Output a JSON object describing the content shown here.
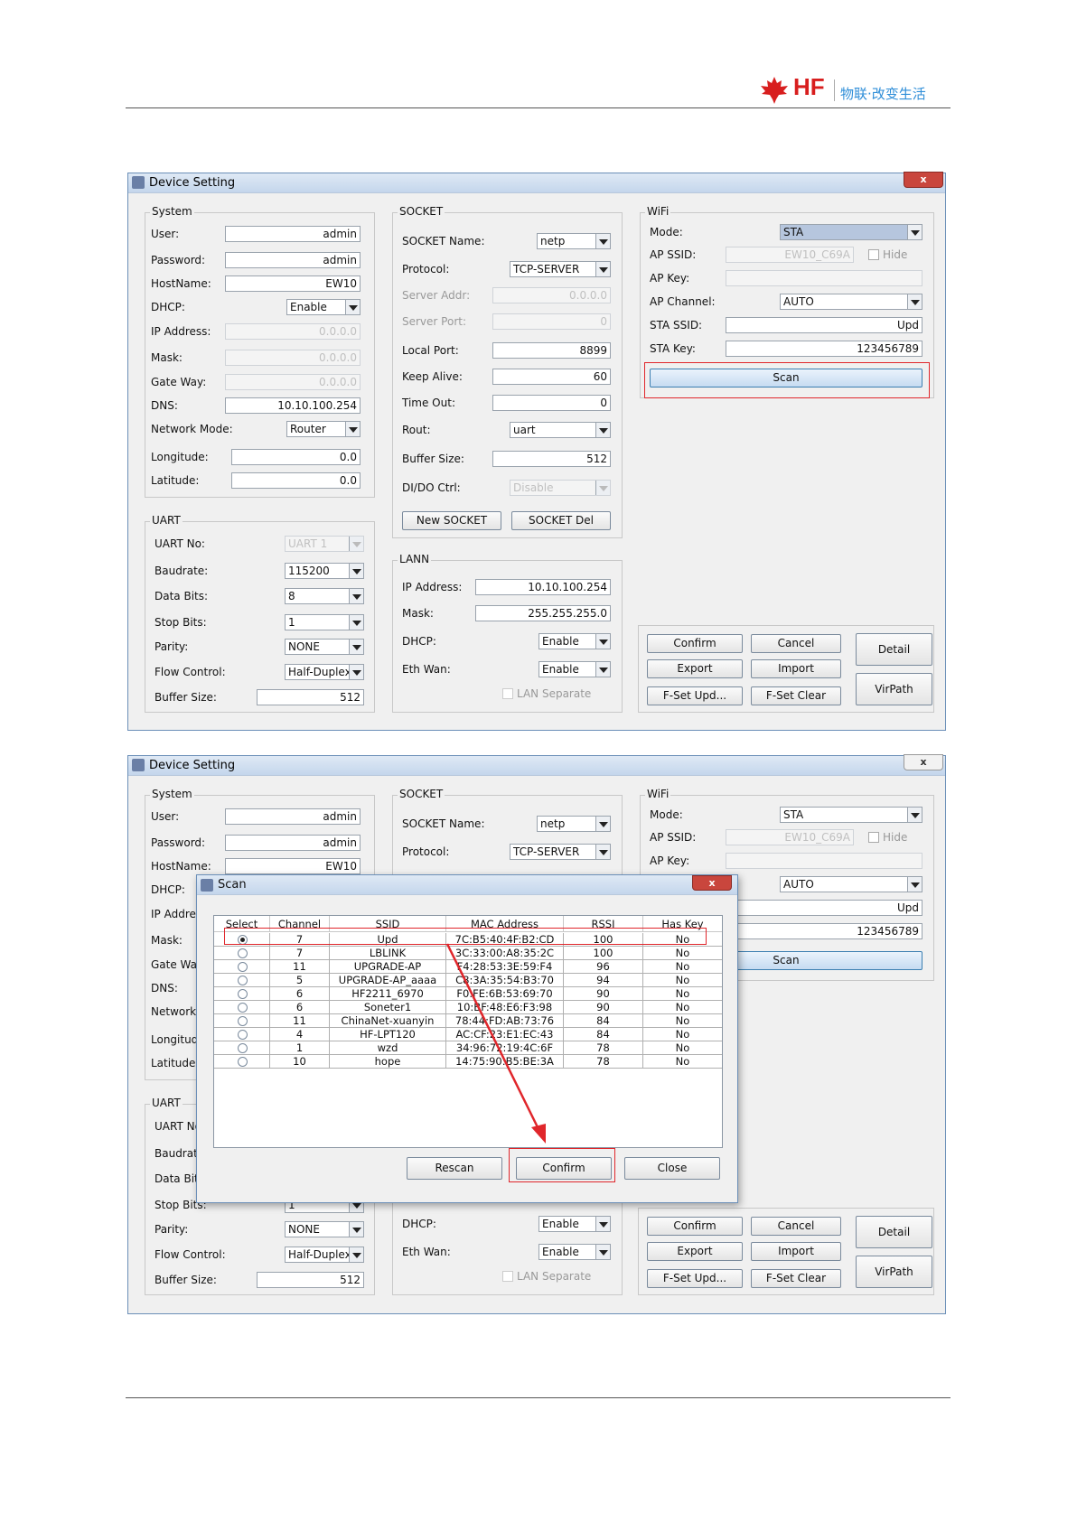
{
  "header": {
    "logo_text": "HF",
    "slogan": "物联·改变生活"
  },
  "device_window_title": "Device Setting",
  "close_glyph": "x",
  "system": {
    "legend": "System",
    "user_label": "User:",
    "user_value": "admin",
    "password_label": "Password:",
    "password_value": "admin",
    "hostname_label": "HostName:",
    "hostname_value": "EW10",
    "dhcp_label": "DHCP:",
    "dhcp_value": "Enable",
    "ip_label": "IP Address:",
    "ip_value": "0.0.0.0",
    "mask_label": "Mask:",
    "mask_value": "0.0.0.0",
    "gateway_label": "Gate Way:",
    "gateway_value": "0.0.0.0",
    "dns_label": "DNS:",
    "dns_value": "10.10.100.254",
    "netmode_label": "Network Mode:",
    "netmode_value": "Router",
    "longitude_label": "Longitude:",
    "longitude_value": "0.0",
    "latitude_label": "Latitude:",
    "latitude_value": "0.0"
  },
  "uart": {
    "legend": "UART",
    "no_label": "UART No:",
    "no_value": "UART 1",
    "baud_label": "Baudrate:",
    "baud_value": "115200",
    "databits_label": "Data Bits:",
    "databits_value": "8",
    "stopbits_label": "Stop Bits:",
    "stopbits_value": "1",
    "parity_label": "Parity:",
    "parity_value": "NONE",
    "flow_label": "Flow Control:",
    "flow_value": "Half-Duplex",
    "buffer_label": "Buffer Size:",
    "buffer_value": "512"
  },
  "socket": {
    "legend": "SOCKET",
    "name_label": "SOCKET Name:",
    "name_value": "netp",
    "protocol_label": "Protocol:",
    "protocol_value": "TCP-SERVER",
    "server_addr_label": "Server Addr:",
    "server_addr_value": "0.0.0.0",
    "server_port_label": "Server Port:",
    "server_port_value": "0",
    "local_port_label": "Local Port:",
    "local_port_value": "8899",
    "keepalive_label": "Keep Alive:",
    "keepalive_value": "60",
    "timeout_label": "Time Out:",
    "timeout_value": "0",
    "rout_label": "Rout:",
    "rout_value": "uart",
    "buffer_label": "Buffer Size:",
    "buffer_value": "512",
    "dido_label": "DI/DO Ctrl:",
    "dido_value": "Disable",
    "new_btn": "New SOCKET",
    "del_btn": "SOCKET Del"
  },
  "lann": {
    "legend": "LANN",
    "ip_label": "IP Address:",
    "ip_value": "10.10.100.254",
    "mask_label": "Mask:",
    "mask_value": "255.255.255.0",
    "dhcp_label": "DHCP:",
    "dhcp_value": "Enable",
    "ethwan_label": "Eth Wan:",
    "ethwan_value": "Enable",
    "separate_label": "LAN Separate"
  },
  "wifi": {
    "legend": "WiFi",
    "mode_label": "Mode:",
    "mode_value": "STA",
    "apssid_label": "AP SSID:",
    "apssid_value": "EW10_C69A",
    "hide_label": "Hide",
    "apkey_label": "AP Key:",
    "apkey_value": "",
    "apchannel_label": "AP Channel:",
    "apchannel_value": "AUTO",
    "stassid_label": "STA SSID:",
    "stassid_value": "Upd",
    "stakey_label": "STA Key:",
    "stakey_value": "123456789",
    "scan_btn": "Scan"
  },
  "actions": {
    "confirm": "Confirm",
    "cancel": "Cancel",
    "detail": "Detail",
    "export": "Export",
    "import": "Import",
    "fset_upd": "F-Set Upd...",
    "fset_clear": "F-Set Clear",
    "virpath": "VirPath"
  },
  "scan_dialog": {
    "title": "Scan",
    "columns": [
      "Select",
      "Channel",
      "SSID",
      "MAC Address",
      "RSSI",
      "Has Key"
    ],
    "rows": [
      {
        "channel": "7",
        "ssid": "Upd",
        "mac": "7C:B5:40:4F:B2:CD",
        "rssi": "100",
        "haskey": "No",
        "selected": true
      },
      {
        "channel": "7",
        "ssid": "LBLINK",
        "mac": "3C:33:00:A8:35:2C",
        "rssi": "100",
        "haskey": "No",
        "selected": false
      },
      {
        "channel": "11",
        "ssid": "UPGRADE-AP",
        "mac": "F4:28:53:3E:59:F4",
        "rssi": "96",
        "haskey": "No",
        "selected": false
      },
      {
        "channel": "5",
        "ssid": "UPGRADE-AP_aaaa",
        "mac": "C8:3A:35:54:B3:70",
        "rssi": "94",
        "haskey": "No",
        "selected": false
      },
      {
        "channel": "6",
        "ssid": "HF2211_6970",
        "mac": "F0:FE:6B:53:69:70",
        "rssi": "90",
        "haskey": "No",
        "selected": false
      },
      {
        "channel": "6",
        "ssid": "Soneter1",
        "mac": "10:BF:48:E6:F3:98",
        "rssi": "90",
        "haskey": "No",
        "selected": false
      },
      {
        "channel": "11",
        "ssid": "ChinaNet-xuanyin",
        "mac": "78:44:FD:AB:73:76",
        "rssi": "84",
        "haskey": "No",
        "selected": false
      },
      {
        "channel": "4",
        "ssid": "HF-LPT120",
        "mac": "AC:CF:23:E1:EC:43",
        "rssi": "84",
        "haskey": "No",
        "selected": false
      },
      {
        "channel": "1",
        "ssid": "wzd",
        "mac": "34:96:72:19:4C:6F",
        "rssi": "78",
        "haskey": "No",
        "selected": false
      },
      {
        "channel": "10",
        "ssid": "hope",
        "mac": "14:75:90:B5:BE:3A",
        "rssi": "78",
        "haskey": "No",
        "selected": false
      }
    ],
    "rescan_btn": "Rescan",
    "confirm_btn": "Confirm",
    "close_btn": "Close"
  },
  "colors": {
    "highlight_red": "#e0262b",
    "brand_red": "#d81e1e",
    "slogan_blue": "#2f8ed8"
  }
}
